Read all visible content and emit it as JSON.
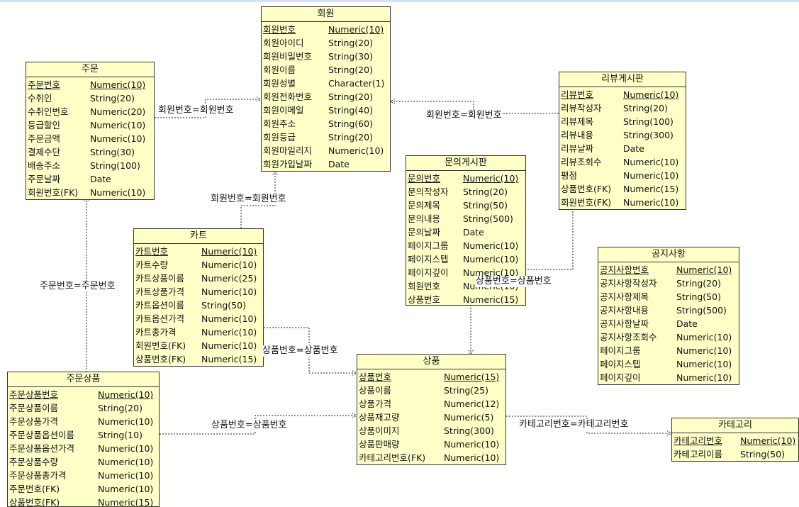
{
  "entities": {
    "member": {
      "title": "회원",
      "attributes": [
        {
          "name": "회원번호",
          "type": "Numeric(10)",
          "pk": true
        },
        {
          "name": "회원아이디",
          "type": "String(20)"
        },
        {
          "name": "회원비밀번호",
          "type": "String(30)"
        },
        {
          "name": "회원이름",
          "type": "String(20)"
        },
        {
          "name": "회원성별",
          "type": "Character(1)"
        },
        {
          "name": "회원전화번호",
          "type": "String(20)"
        },
        {
          "name": "회원이메일",
          "type": "String(40)"
        },
        {
          "name": "회원주소",
          "type": "String(60)"
        },
        {
          "name": "회원등급",
          "type": "String(20)"
        },
        {
          "name": "회원마일리지",
          "type": "Numeric(10)"
        },
        {
          "name": "회원가입날짜",
          "type": "Date"
        }
      ]
    },
    "order": {
      "title": "주문",
      "attributes": [
        {
          "name": "주문번호",
          "type": "Numeric(10)",
          "pk": true
        },
        {
          "name": "수취인",
          "type": "String(20)"
        },
        {
          "name": "수취인번호",
          "type": "Numeric(20)"
        },
        {
          "name": "등급할인",
          "type": "Numeric(10)"
        },
        {
          "name": "주문금액",
          "type": "Numeric(10)"
        },
        {
          "name": "결제수단",
          "type": "String(30)"
        },
        {
          "name": "배송주소",
          "type": "String(100)"
        },
        {
          "name": "주문날짜",
          "type": "Date"
        },
        {
          "name": "회원번호(FK)",
          "type": "Numeric(10)"
        }
      ]
    },
    "review": {
      "title": "리뷰게시판",
      "attributes": [
        {
          "name": "리뷰번호",
          "type": "Numeric(10)",
          "pk": true
        },
        {
          "name": "리뷰작성자",
          "type": "String(20)"
        },
        {
          "name": "리뷰제목",
          "type": "String(100)"
        },
        {
          "name": "리뷰내용",
          "type": "String(300)"
        },
        {
          "name": "리뷰날짜",
          "type": "Date"
        },
        {
          "name": "리뷰조회수",
          "type": "Numeric(10)"
        },
        {
          "name": "평점",
          "type": "Numeric(10)"
        },
        {
          "name": "상품번호(FK)",
          "type": "Numeric(15)"
        },
        {
          "name": "회원번호(FK)",
          "type": "Numeric(10)"
        }
      ]
    },
    "inquiry": {
      "title": "문의게시판",
      "attributes": [
        {
          "name": "문의번호",
          "type": "Numeric(10)",
          "pk": true
        },
        {
          "name": "문의작성자",
          "type": "String(20)"
        },
        {
          "name": "문의제목",
          "type": "String(50)"
        },
        {
          "name": "문의내용",
          "type": "String(500)"
        },
        {
          "name": "문의날짜",
          "type": "Date"
        },
        {
          "name": "페이지그룹",
          "type": "Numeric(10)"
        },
        {
          "name": "페이지스텝",
          "type": "Numeric(10)"
        },
        {
          "name": "페이지깊이",
          "type": "Numeric(10)"
        },
        {
          "name": "회원번호",
          "type": "Numeric(10)"
        },
        {
          "name": "상품번호",
          "type": "Numeric(15)"
        }
      ]
    },
    "cart": {
      "title": "카트",
      "attributes": [
        {
          "name": "카트번호",
          "type": "Numeric(10)",
          "pk": true
        },
        {
          "name": "카트수량",
          "type": "Numeric(10)"
        },
        {
          "name": "카트상품이름",
          "type": "Numeric(25)"
        },
        {
          "name": "카트상품가격",
          "type": "Numeric(10)"
        },
        {
          "name": "카트옵션이름",
          "type": "String(50)"
        },
        {
          "name": "카트옵션가격",
          "type": "Numeric(10)"
        },
        {
          "name": "카트총가격",
          "type": "Numeric(10)"
        },
        {
          "name": "회원번호(FK)",
          "type": "Numeric(10)"
        },
        {
          "name": "상품번호(FK)",
          "type": "Numeric(15)"
        }
      ]
    },
    "notice": {
      "title": "공지사항",
      "attributes": [
        {
          "name": "공지사항번호",
          "type": "Numeric(10)",
          "pk": true
        },
        {
          "name": "공지사항작성자",
          "type": "String(20)"
        },
        {
          "name": "공지사항제목",
          "type": "String(50)"
        },
        {
          "name": "공지사항내용",
          "type": "String(500)"
        },
        {
          "name": "공지사항날짜",
          "type": "Date"
        },
        {
          "name": "공지사항조회수",
          "type": "Numeric(10)"
        },
        {
          "name": "페이지그룹",
          "type": "Numeric(10)"
        },
        {
          "name": "페이지스텝",
          "type": "Numeric(10)"
        },
        {
          "name": "페이지깊이",
          "type": "Numeric(10)"
        }
      ]
    },
    "product": {
      "title": "상품",
      "attributes": [
        {
          "name": "상품번호",
          "type": "Numeric(15)",
          "pk": true
        },
        {
          "name": "상품이름",
          "type": "String(25)"
        },
        {
          "name": "상품가격",
          "type": "Numeric(12)"
        },
        {
          "name": "상품재고량",
          "type": "Numeric(5)"
        },
        {
          "name": "상품이미지",
          "type": "String(300)"
        },
        {
          "name": "상품판매량",
          "type": "Numeric(10)"
        },
        {
          "name": "카테고리번호(FK)",
          "type": "Numeric(10)"
        }
      ]
    },
    "order_item": {
      "title": "주문상품",
      "attributes": [
        {
          "name": "주문상품번호",
          "type": "Numeric(10)",
          "pk": true
        },
        {
          "name": "주문상품이름",
          "type": "String(20)"
        },
        {
          "name": "주문상품가격",
          "type": "Numeric(10)"
        },
        {
          "name": "주문상품옵션이름",
          "type": "String(10)"
        },
        {
          "name": "주문상품옵션가격",
          "type": "Numeric(10)"
        },
        {
          "name": "주문상품수량",
          "type": "Numeric(10)"
        },
        {
          "name": "주문상품총가격",
          "type": "Numeric(10)"
        },
        {
          "name": "주문번호(FK)",
          "type": "Numeric(10)"
        },
        {
          "name": "상품번호(FK)",
          "type": "Numeric(15)"
        }
      ]
    },
    "category": {
      "title": "카테고리",
      "attributes": [
        {
          "name": "카테고리번호",
          "type": "Numeric(10)",
          "pk": true
        },
        {
          "name": "카테고리이름",
          "type": "String(50)"
        }
      ]
    }
  },
  "relationships": {
    "order_member": "회원번호=회원번호",
    "review_member": "회원번호=회원번호",
    "cart_member": "회원번호=회원번호",
    "orderitem_order": "주문번호=주문번호",
    "review_product": "상품번호=상품번호",
    "cart_product": "상품번호=상품번호",
    "orderitem_product": "상품번호=상품번호",
    "product_category": "카테고리번호=카테고리번호"
  },
  "colors": {
    "entity_fill": "#ffffc8",
    "entity_border": "#333333",
    "connector": "#222222"
  }
}
